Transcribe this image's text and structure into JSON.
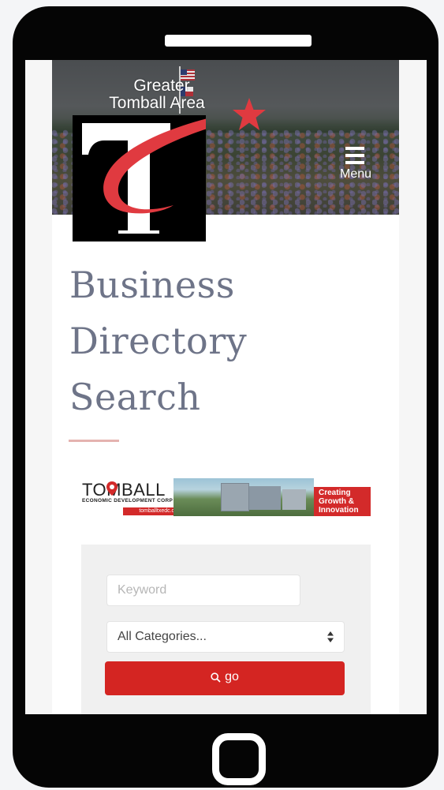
{
  "header": {
    "logo_line1": "Greater",
    "logo_line2": "Tomball Area",
    "menu_label": "Menu"
  },
  "main": {
    "title_lines": [
      "Business",
      "Directory",
      "Search"
    ]
  },
  "ad": {
    "brand": "TOMBALL",
    "sub": "ECONOMIC DEVELOPMENT CORP",
    "url": "tomballtxedc.org",
    "tagline": [
      "Creating",
      "Growth &",
      "Innovation"
    ]
  },
  "search": {
    "keyword_placeholder": "Keyword",
    "keyword_value": "",
    "category_selected": "All Categories...",
    "go_label": "go"
  },
  "icons": {
    "menu": "hamburger-icon",
    "search": "magnifier-icon",
    "select": "up-down-arrows-icon",
    "home": "home-button-icon",
    "star": "star-icon"
  },
  "colors": {
    "accent_red": "#d42522",
    "title_slate": "#6e7488",
    "rule_pink": "#e5b3b0",
    "phone_frame": "#050505"
  }
}
